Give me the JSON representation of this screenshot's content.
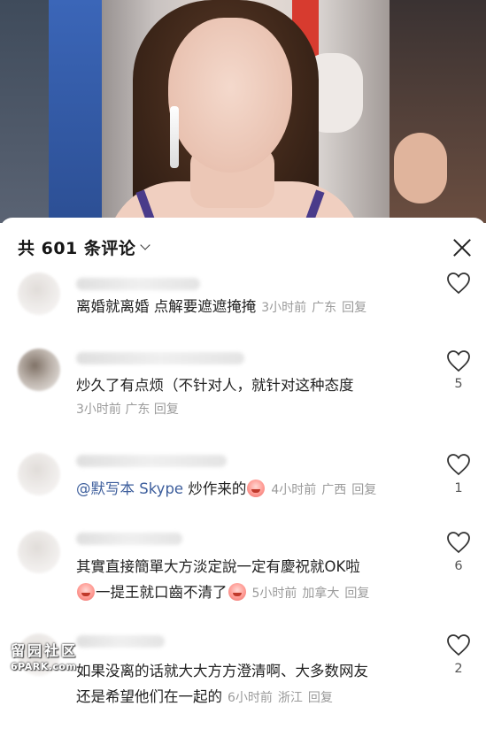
{
  "video": {
    "description_hidden": ""
  },
  "header": {
    "count_label": "共 601 条评论"
  },
  "comments": [
    {
      "text": "离婚就离婚 点解要遮遮掩掩",
      "time": "3小时前",
      "location": "广东",
      "reply": "回复",
      "likes": ""
    },
    {
      "text": "炒久了有点烦（不针对人，就针对这种态度",
      "time": "3小时前",
      "location": "广东",
      "reply": "回复",
      "likes": "5"
    },
    {
      "mention": "@默写本 Skype",
      "text": " 炒作来的",
      "time": "4小时前",
      "location": "广西",
      "reply": "回复",
      "likes": "1"
    },
    {
      "text_line1": "其實直接簡單大方淡定說一定有慶祝就OK啦",
      "text_line2": "一提王就口齒不清了",
      "time": "5小时前",
      "location": "加拿大",
      "reply": "回复",
      "likes": "6"
    },
    {
      "text_line1": "如果没离的话就大大方方澄清啊、大多数网友",
      "text_line2": "还是希望他们在一起的",
      "time": "6小时前",
      "location": "浙江",
      "reply": "回复",
      "likes": "2"
    }
  ],
  "watermark": {
    "line1": "留园社区",
    "line2": "6PARK.com"
  },
  "colors": {
    "mention": "#3d5e9c",
    "meta": "#9a9a9a",
    "text": "#222222"
  }
}
